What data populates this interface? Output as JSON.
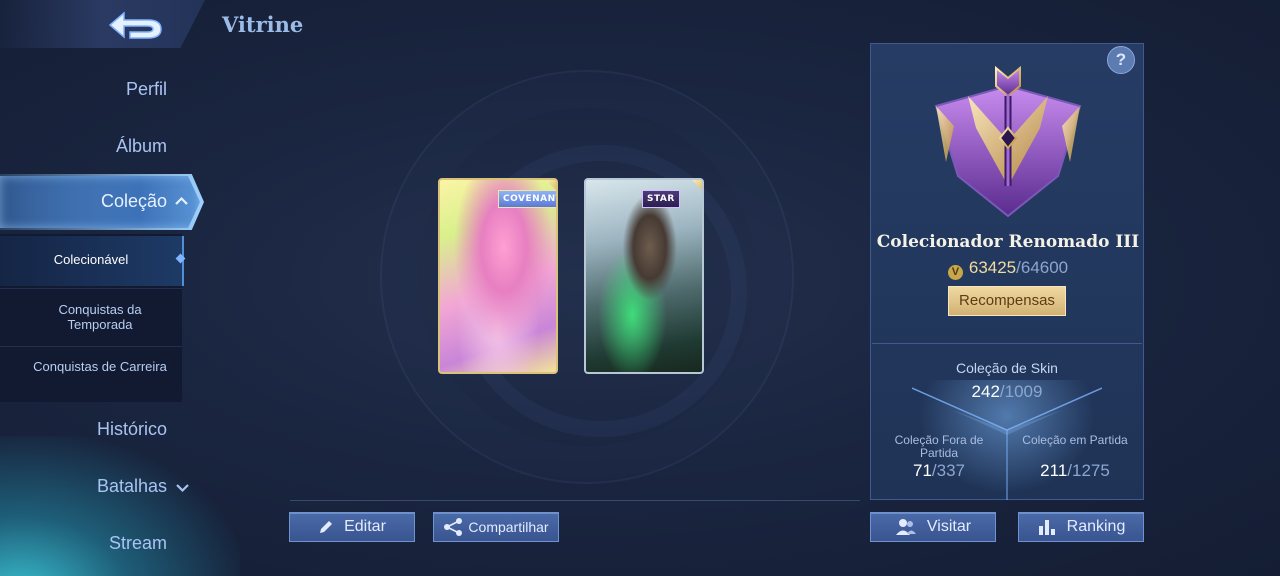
{
  "header": {
    "title": "Vitrine"
  },
  "sidebar": {
    "items": [
      {
        "label": "Perfil"
      },
      {
        "label": "Álbum"
      },
      {
        "label": "Coleção"
      },
      {
        "label": "Histórico"
      },
      {
        "label": "Batalhas"
      },
      {
        "label": "Stream"
      }
    ],
    "submenu": [
      {
        "label": "Colecionável"
      },
      {
        "label": "Conquistas da Temporada"
      },
      {
        "label": "Conquistas de Carreira"
      }
    ]
  },
  "showcase": {
    "cards": [
      {
        "badge": "COVENANT"
      },
      {
        "badge": "STAR"
      }
    ]
  },
  "actions": {
    "edit_label": "Editar",
    "share_label": "Compartilhar",
    "visit_label": "Visitar",
    "ranking_label": "Ranking"
  },
  "panel": {
    "rank_title": "Colecionador Renomado III",
    "points_current": "63425",
    "points_max": "/64600",
    "rewards_label": "Recompensas",
    "skin_collection": {
      "label": "Coleção de Skin",
      "current": "242",
      "max": "/1009"
    },
    "outside_match": {
      "label": "Coleção Fora de Partida",
      "current": "71",
      "max": "/337"
    },
    "in_match": {
      "label": "Coleção em Partida",
      "current": "211",
      "max": "/1275"
    }
  },
  "colors": {
    "accent": "#4a6aa8",
    "gold": "#f1dca0",
    "panel": "#22375c"
  }
}
